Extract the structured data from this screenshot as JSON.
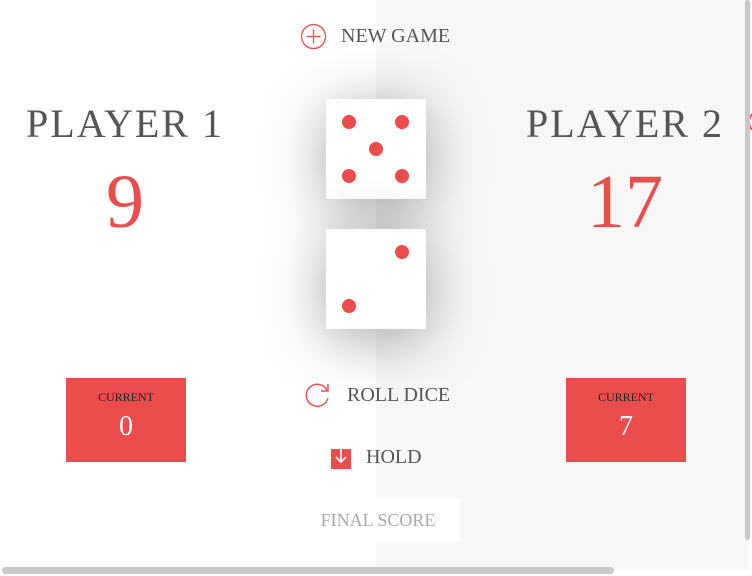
{
  "colors": {
    "accent": "#EB4D4D",
    "left_panel": "#FFFFFF",
    "right_panel": "#F7F7F7"
  },
  "controls": {
    "new_game": {
      "label": "NEW GAME",
      "icon": "plus-circle-icon"
    },
    "roll_dice": {
      "label": "ROLL DICE",
      "icon": "refresh-icon"
    },
    "hold": {
      "label": "HOLD",
      "icon": "download-icon"
    },
    "final_score_placeholder": "FINAL SCORE"
  },
  "players": [
    {
      "name": "PLAYER 1",
      "score": "9",
      "current_label": "CURRENT",
      "current": "0",
      "active": false
    },
    {
      "name": "PLAYER 2",
      "score": "17",
      "current_label": "CURRENT",
      "current": "7",
      "active": true
    }
  ],
  "dice": [
    5,
    2
  ]
}
